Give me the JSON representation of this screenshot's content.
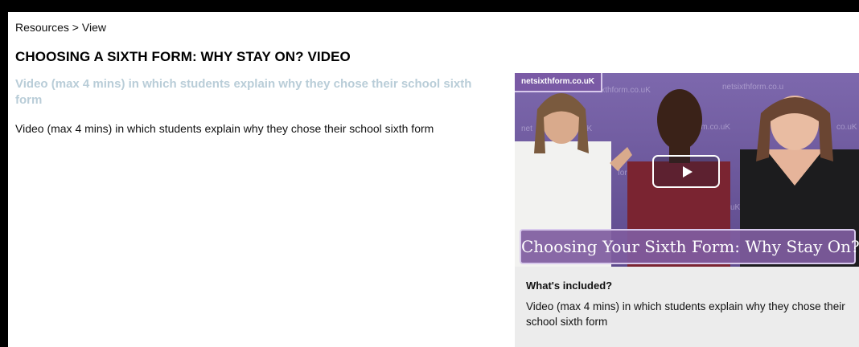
{
  "breadcrumb": "Resources > View",
  "page_title": "CHOOSING A SIXTH FORM: WHY STAY ON? VIDEO",
  "subtitle": "Video (max 4 mins) in which students explain why they chose their school sixth form",
  "description": "Video (max 4 mins) in which students explain why they chose their school sixth form",
  "video": {
    "brand_tag": "netsixthform.co.uK",
    "caption": "Choosing Your Sixth Form: Why Stay On?",
    "play_icon": "play-icon"
  },
  "included": {
    "heading": "What's included?",
    "text": "Video (max 4 mins) in which students explain why they chose their school sixth form"
  },
  "colors": {
    "subtitle": "#b9cdd8",
    "brand_purple": "#7f5ca0",
    "card_bg": "#ececec"
  }
}
